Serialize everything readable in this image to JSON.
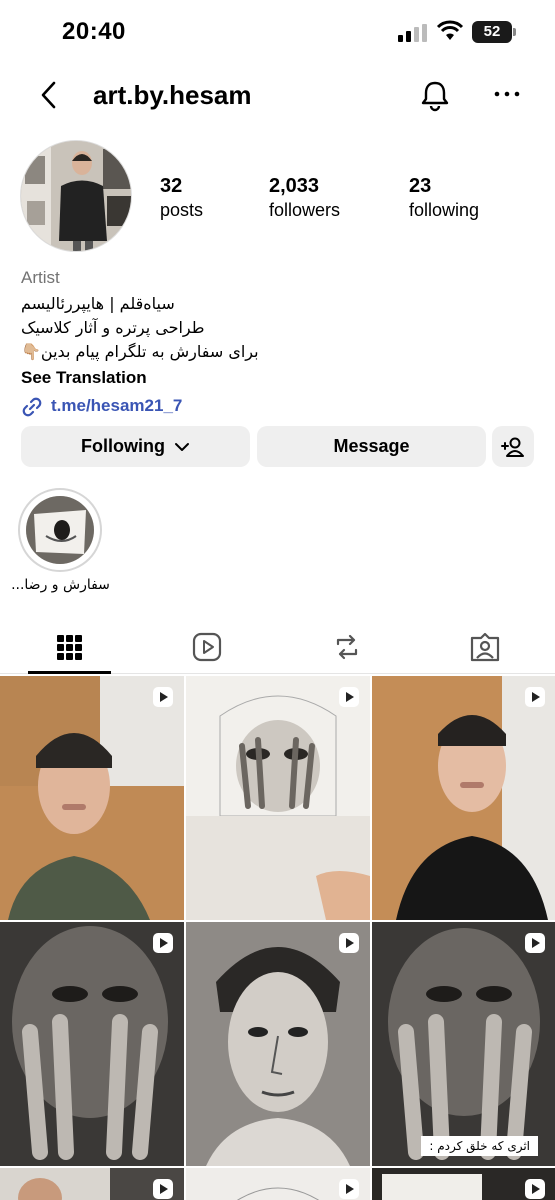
{
  "status": {
    "time": "20:40",
    "battery": "52"
  },
  "header": {
    "username": "art.by.hesam"
  },
  "stats": [
    {
      "value": "32",
      "label": "posts"
    },
    {
      "value": "2,033",
      "label": "followers"
    },
    {
      "value": "23",
      "label": "following"
    }
  ],
  "bio": {
    "category": "Artist",
    "line1": "سیاه‌قلم | هایپررئالیسم",
    "line2": "طراحی پرتره و آثار کلاسیک",
    "line3": "برای سفارش به تلگرام پیام بدین👇🏼",
    "see_translation": "See Translation",
    "link": "t.me/hesam21_7"
  },
  "buttons": {
    "following": "Following",
    "message": "Message"
  },
  "highlight": {
    "label": "سفارش و رضا..."
  },
  "tabs": [
    "posts-grid-icon",
    "reels-icon",
    "reposts-icon",
    "tagged-icon"
  ],
  "grid": {
    "caption": "اثری که خلق کردم :"
  }
}
